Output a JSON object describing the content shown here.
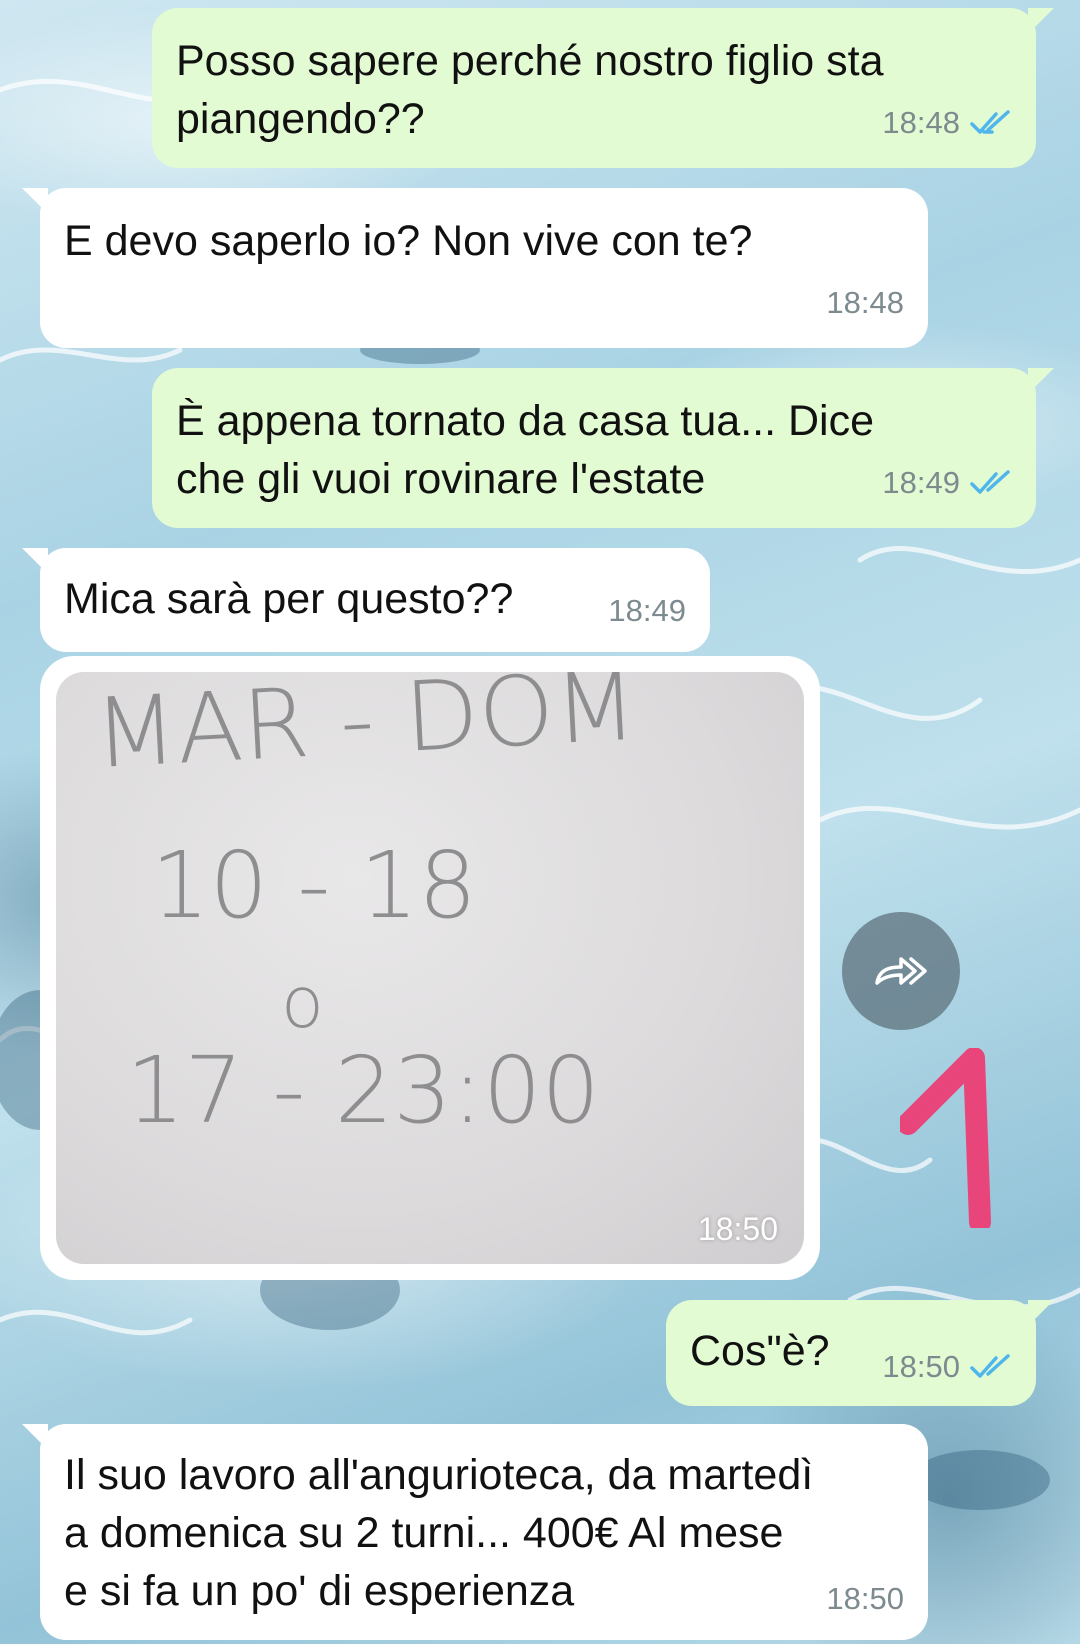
{
  "chat": {
    "messages": [
      {
        "direction": "outgoing",
        "lines": [
          "Posso sapere perché nostro figlio sta",
          "piangendo??"
        ],
        "time": "18:48",
        "status": "read"
      },
      {
        "direction": "incoming",
        "lines": [
          "E devo saperlo io? Non vive con te?"
        ],
        "time": "18:48"
      },
      {
        "direction": "outgoing",
        "lines": [
          "È appena tornato da casa tua... Dice",
          "che gli vuoi rovinare l'estate"
        ],
        "time": "18:49",
        "status": "read"
      },
      {
        "direction": "incoming",
        "lines": [
          "Mica sarà per questo??"
        ],
        "time": "18:49"
      },
      {
        "direction": "incoming",
        "type": "image",
        "image_text": [
          "MAR - DOM",
          "10 - 18",
          "o",
          "17 - 23:00"
        ],
        "time": "18:50"
      },
      {
        "direction": "outgoing",
        "lines": [
          "Cos\"è?"
        ],
        "time": "18:50",
        "status": "read"
      },
      {
        "direction": "incoming",
        "lines": [
          "Il suo lavoro all'angurioteca, da martedì",
          "a domenica su 2 turni... 400€ Al mese",
          "e si fa un po' di esperienza"
        ],
        "time": "18:50"
      }
    ]
  },
  "overlay": {
    "annotation_number": "1",
    "annotation_color": "#e8457a"
  },
  "icons": {
    "forward": "forward-icon",
    "read_ticks": "double-check-icon"
  },
  "colors": {
    "outgoing_bubble": "#e3fbd3",
    "incoming_bubble": "#ffffff",
    "read_tick": "#4fb6ec",
    "timestamp": "#7d8a8f"
  }
}
